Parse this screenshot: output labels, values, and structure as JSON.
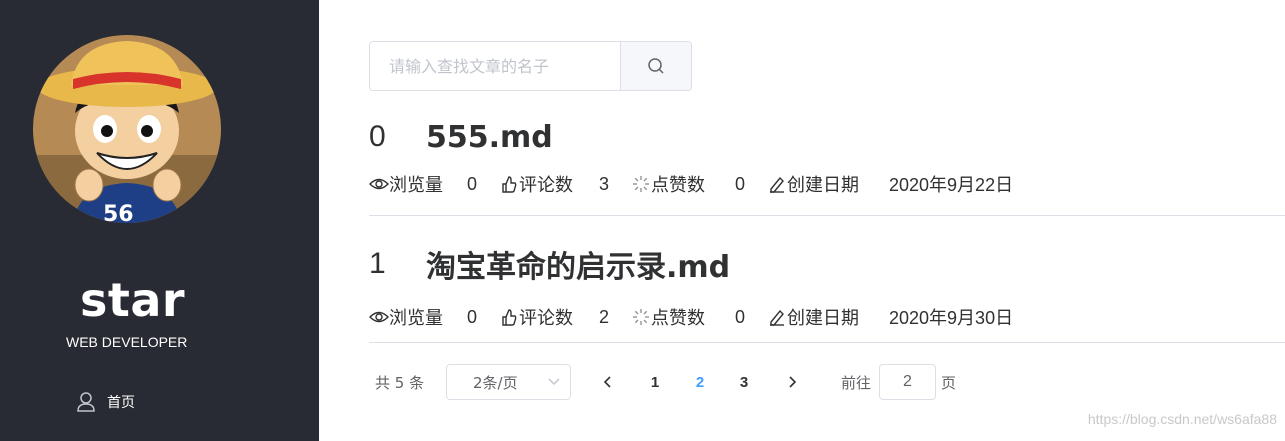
{
  "sidebar": {
    "brand": "star",
    "role": "WEB DEVELOPER",
    "nav": [
      {
        "label": "首页",
        "icon": "user-icon"
      }
    ]
  },
  "search": {
    "placeholder": "请输入查找文章的名子",
    "button_icon": "search-icon"
  },
  "meta_labels": {
    "views": "浏览量",
    "comments": "评论数",
    "likes": "点赞数",
    "created": "创建日期"
  },
  "articles": [
    {
      "index": "0",
      "title": "555.md",
      "views": "0",
      "comments": "3",
      "likes": "0",
      "created": "2020年9月22日"
    },
    {
      "index": "1",
      "title": "淘宝革命的启示录.md",
      "views": "0",
      "comments": "2",
      "likes": "0",
      "created": "2020年9月30日"
    }
  ],
  "pagination": {
    "total_text": "共 5 条",
    "page_size": "2条/页",
    "pages": [
      "1",
      "2",
      "3"
    ],
    "current_page": "2",
    "goto_prefix": "前往",
    "goto_value": "2",
    "goto_suffix": "页"
  },
  "watermark": "https://blog.csdn.net/ws6afa88",
  "colors": {
    "sidebar_bg": "#282b33",
    "accent": "#409eff",
    "text": "#303133",
    "border": "#dcdfe6"
  }
}
